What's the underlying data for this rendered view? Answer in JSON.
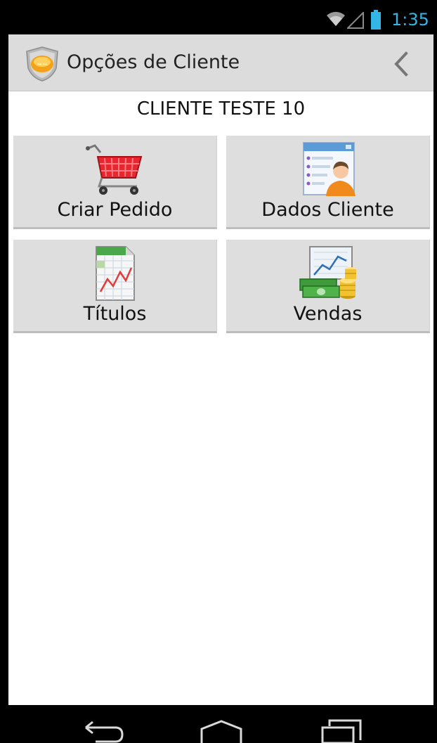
{
  "status_bar": {
    "time": "1:35"
  },
  "action_bar": {
    "title": "Opções de Cliente"
  },
  "client": {
    "name": "CLIENTE TESTE 10"
  },
  "tiles": [
    {
      "label": "Criar Pedido",
      "icon": "shopping-cart-icon"
    },
    {
      "label": "Dados Cliente",
      "icon": "client-card-icon"
    },
    {
      "label": "Títulos",
      "icon": "spreadsheet-chart-icon"
    },
    {
      "label": "Vendas",
      "icon": "sales-chart-money-icon"
    }
  ],
  "colors": {
    "clock": "#33b5e5",
    "action_bar": "#dcdcdc",
    "tile": "#dedede"
  }
}
